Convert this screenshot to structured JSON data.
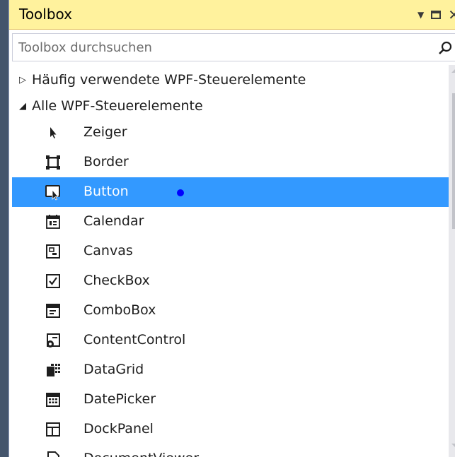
{
  "toolbox": {
    "title": "Toolbox",
    "search_placeholder": "Toolbox durchsuchen"
  },
  "icons": {
    "search": "magnifier-icon",
    "dropdown": "dropdown-arrow-icon",
    "maximize": "maximize-icon",
    "close": "close-icon"
  },
  "colors": {
    "titlebar_bg": "#fff29d",
    "selection_bg": "#3399ff",
    "dot": "#0000ff"
  },
  "categories": [
    {
      "label": "Häufig verwendete WPF-Steuerelemente",
      "expanded": false
    },
    {
      "label": "Alle WPF-Steuerelemente",
      "expanded": true
    }
  ],
  "items": [
    {
      "label": "Zeiger",
      "icon": "pointer-icon"
    },
    {
      "label": "Border",
      "icon": "border-icon"
    },
    {
      "label": "Button",
      "icon": "button-icon",
      "selected": true
    },
    {
      "label": "Calendar",
      "icon": "calendar-icon"
    },
    {
      "label": "Canvas",
      "icon": "canvas-icon"
    },
    {
      "label": "CheckBox",
      "icon": "checkbox-icon"
    },
    {
      "label": "ComboBox",
      "icon": "combobox-icon"
    },
    {
      "label": "ContentControl",
      "icon": "contentcontrol-icon"
    },
    {
      "label": "DataGrid",
      "icon": "datagrid-icon"
    },
    {
      "label": "DatePicker",
      "icon": "datepicker-icon"
    },
    {
      "label": "DockPanel",
      "icon": "dockpanel-icon"
    },
    {
      "label": "DocumentViewer",
      "icon": "documentviewer-icon"
    }
  ]
}
